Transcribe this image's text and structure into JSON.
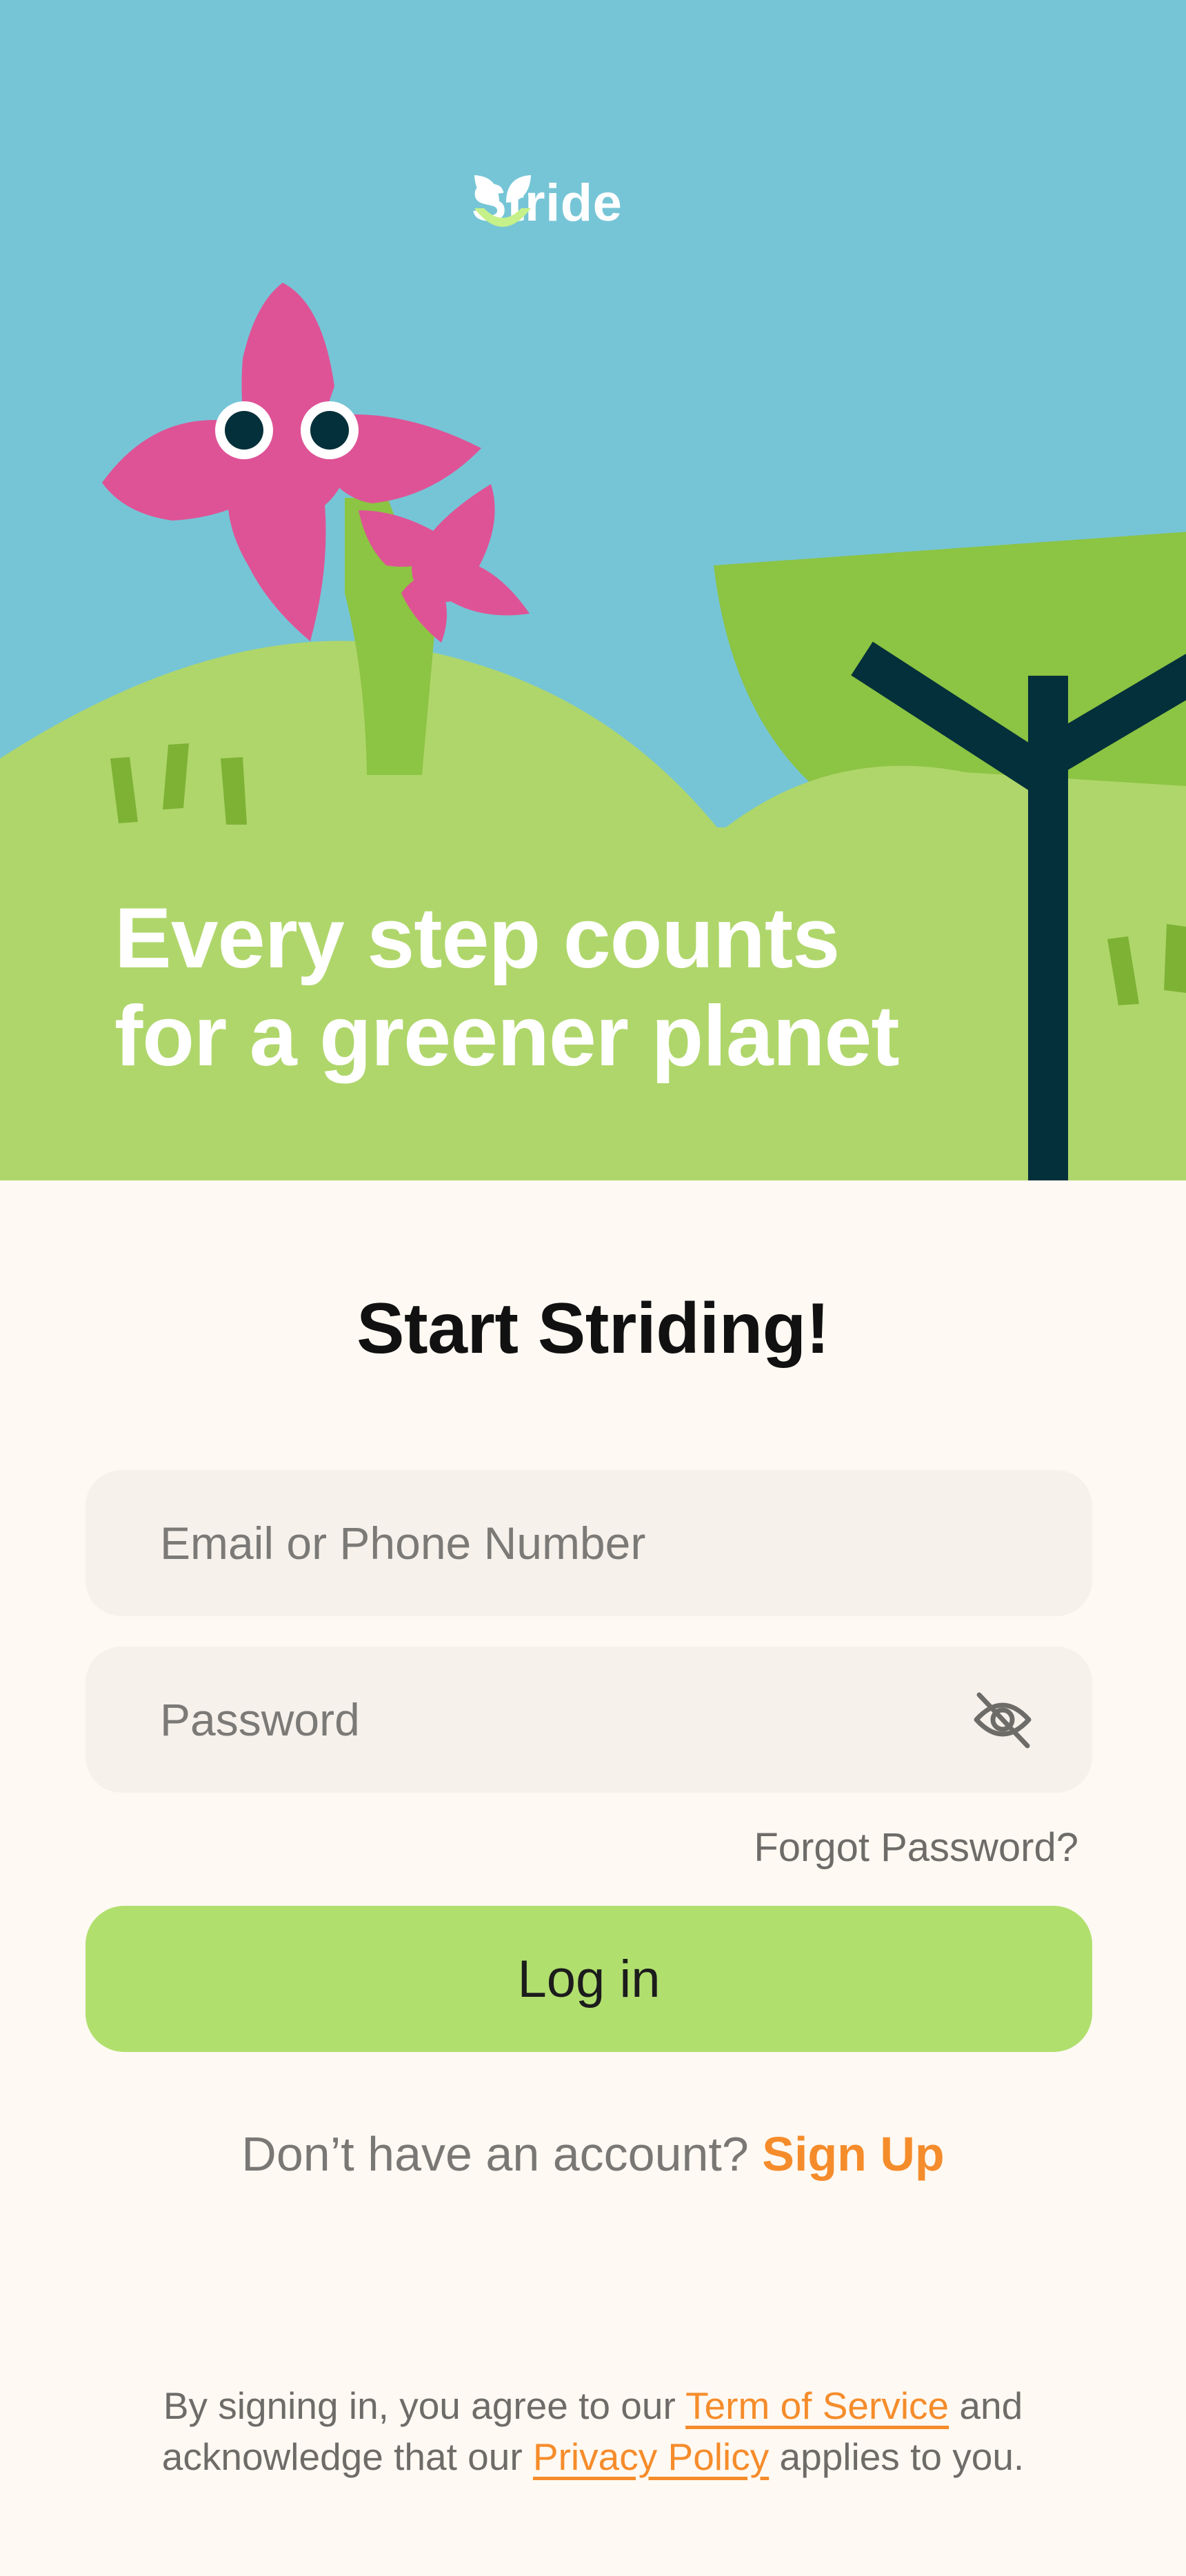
{
  "brand": {
    "name": "Stride"
  },
  "hero": {
    "tagline_line1": "Every step counts",
    "tagline_line2": "for a greener planet"
  },
  "form": {
    "title": "Start Striding!",
    "email_placeholder": "Email or Phone Number",
    "email_value": "",
    "password_placeholder": "Password",
    "password_value": "",
    "password_toggle_icon": "eye-off-icon",
    "forgot_password": "Forgot Password?",
    "login_label": "Log in"
  },
  "signup": {
    "prompt": "Don’t have an account?",
    "link": "Sign Up"
  },
  "legal": {
    "part1": "By signing in, you agree to our",
    "terms_link": "Term of Service",
    "part2": "and",
    "part3": "acknowledge that our",
    "privacy_link": "Privacy Policy",
    "part4": "applies to you."
  },
  "colors": {
    "sky": "#76C5D6",
    "hill": "#AFD66B",
    "tree_canopy": "#8CC443",
    "flower": "#DE5396",
    "tree_trunk": "#03303A",
    "accent": "#F58C2B",
    "button": "#B1DF6E",
    "background": "#FEF9F2"
  }
}
